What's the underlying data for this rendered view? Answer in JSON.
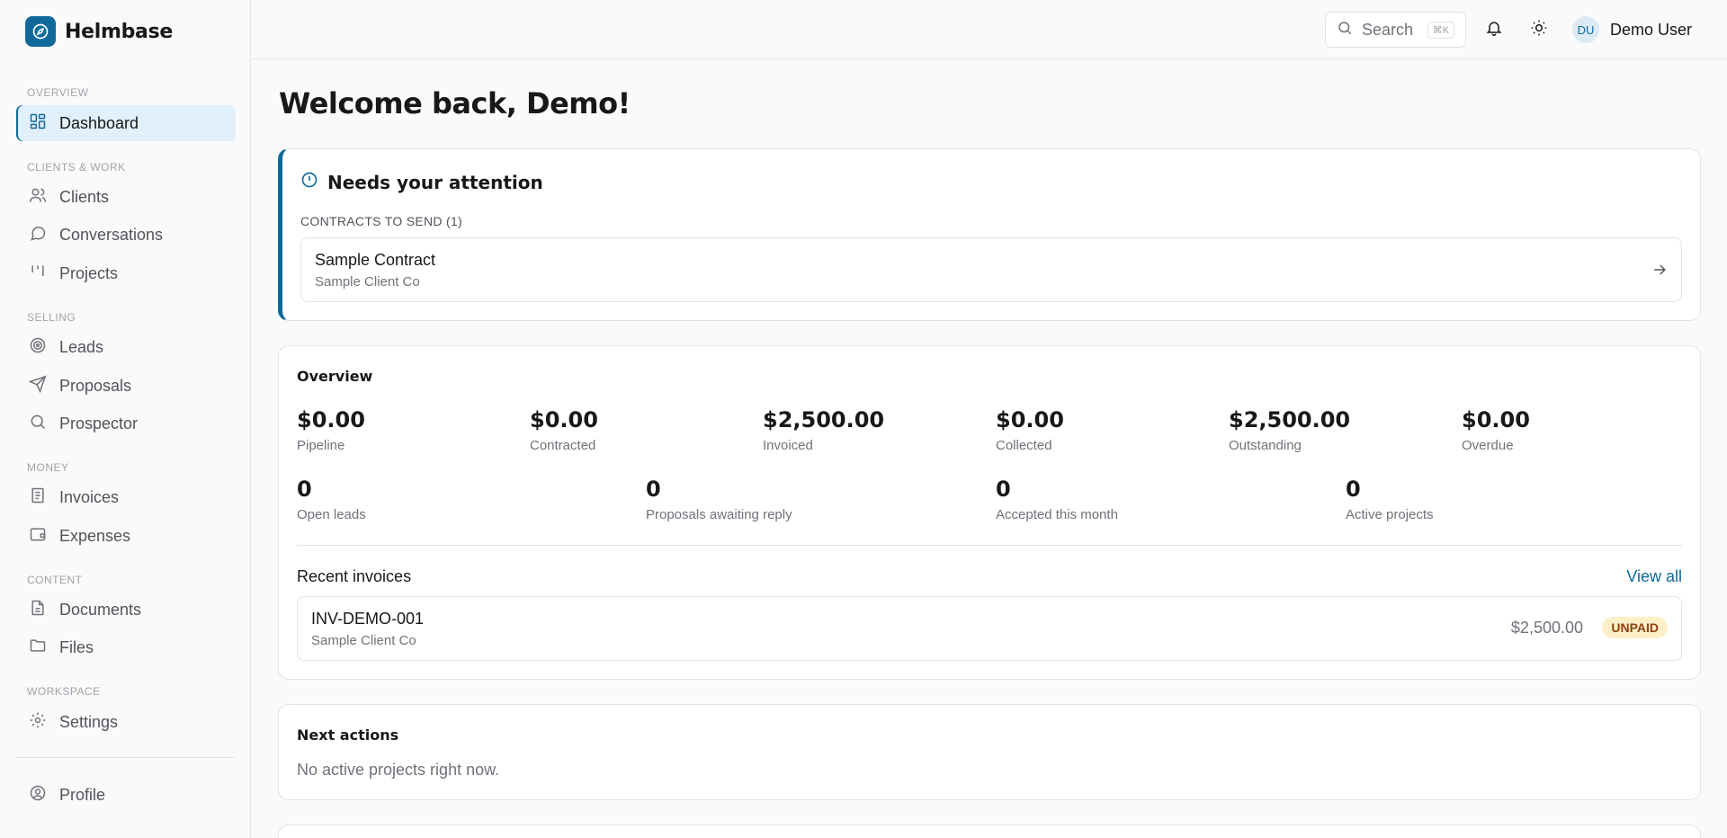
{
  "app": {
    "name": "Helmbase"
  },
  "sidebar": {
    "sections": [
      {
        "label": "OVERVIEW"
      },
      {
        "label": "CLIENTS & WORK"
      },
      {
        "label": "SELLING"
      },
      {
        "label": "MONEY"
      },
      {
        "label": "CONTENT"
      },
      {
        "label": "WORKSPACE"
      }
    ],
    "items": [
      {
        "label": "Dashboard",
        "icon": "dashboard-icon"
      },
      {
        "label": "Clients",
        "icon": "users-icon"
      },
      {
        "label": "Conversations",
        "icon": "chat-icon"
      },
      {
        "label": "Projects",
        "icon": "kanban-icon"
      },
      {
        "label": "Leads",
        "icon": "target-icon"
      },
      {
        "label": "Proposals",
        "icon": "send-icon"
      },
      {
        "label": "Prospector",
        "icon": "search-icon"
      },
      {
        "label": "Invoices",
        "icon": "receipt-icon"
      },
      {
        "label": "Expenses",
        "icon": "wallet-icon"
      },
      {
        "label": "Documents",
        "icon": "document-icon"
      },
      {
        "label": "Files",
        "icon": "folder-icon"
      },
      {
        "label": "Settings",
        "icon": "gear-icon"
      },
      {
        "label": "Profile",
        "icon": "user-circle-icon"
      }
    ]
  },
  "topbar": {
    "search_label": "Search",
    "search_shortcut": "⌘K",
    "user_initials": "DU",
    "user_name": "Demo User"
  },
  "main": {
    "welcome": "Welcome back, Demo!",
    "attention": {
      "title": "Needs your attention",
      "subtitle": "CONTRACTS TO SEND (1)",
      "contract_title": "Sample Contract",
      "contract_client": "Sample Client Co"
    },
    "overview": {
      "title": "Overview",
      "stats_row1": [
        {
          "value": "$0.00",
          "label": "Pipeline"
        },
        {
          "value": "$0.00",
          "label": "Contracted"
        },
        {
          "value": "$2,500.00",
          "label": "Invoiced"
        },
        {
          "value": "$0.00",
          "label": "Collected"
        },
        {
          "value": "$2,500.00",
          "label": "Outstanding"
        },
        {
          "value": "$0.00",
          "label": "Overdue"
        }
      ],
      "stats_row2": [
        {
          "value": "0",
          "label": "Open leads"
        },
        {
          "value": "0",
          "label": "Proposals awaiting reply"
        },
        {
          "value": "0",
          "label": "Accepted this month"
        },
        {
          "value": "0",
          "label": "Active projects"
        }
      ],
      "recent_title": "Recent invoices",
      "view_all": "View all",
      "invoice": {
        "number": "INV-DEMO-001",
        "client": "Sample Client Co",
        "amount": "$2,500.00",
        "status": "UNPAID"
      }
    },
    "next_actions": {
      "title": "Next actions",
      "empty": "No active projects right now."
    }
  },
  "colors": {
    "accent": "#0f6a9a",
    "active_bg": "#e1f0fb",
    "badge_bg": "#fdf0c8",
    "badge_text": "#92400e"
  }
}
